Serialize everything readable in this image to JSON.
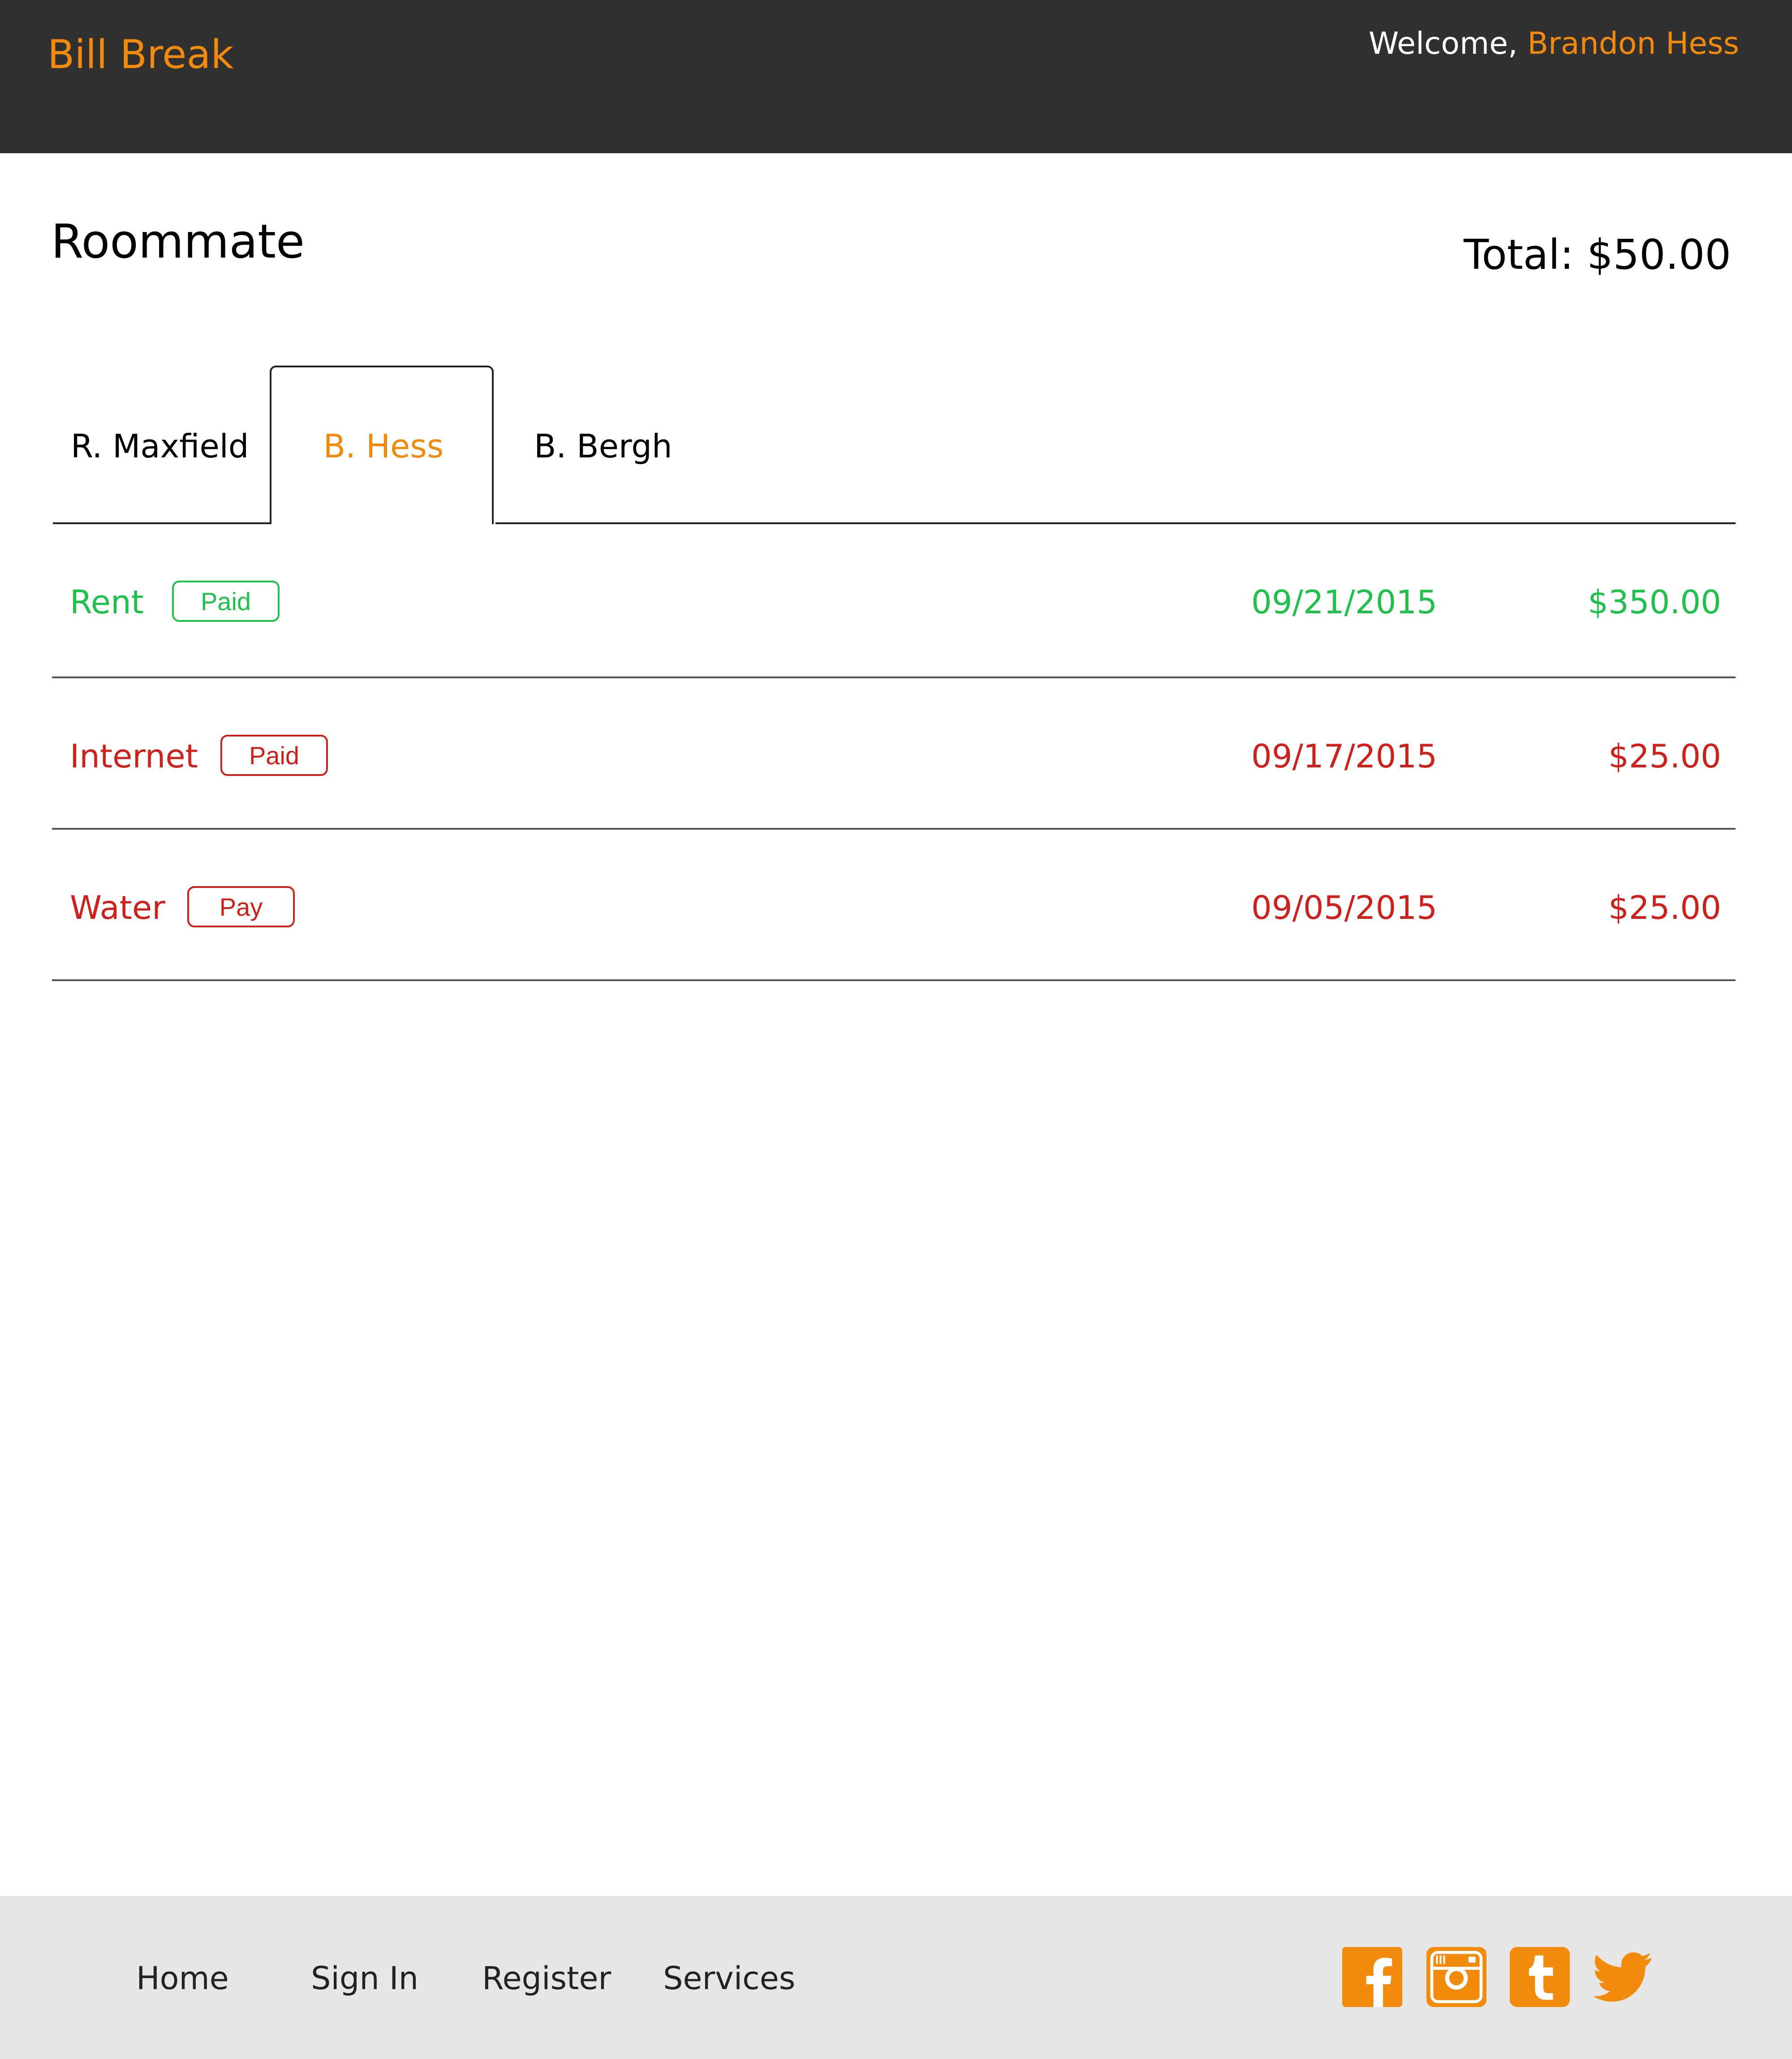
{
  "header": {
    "brand": "Bill Break",
    "welcome_prefix": "Welcome, ",
    "user_name": "Brandon Hess"
  },
  "main": {
    "title": "Roommate",
    "total": "Total: $50.00",
    "tabs": [
      {
        "label": "R. Maxfield",
        "active": false
      },
      {
        "label": "B. Hess",
        "active": true
      },
      {
        "label": "B. Bergh",
        "active": false
      }
    ],
    "bills": [
      {
        "name": "Rent",
        "badge": "Paid",
        "date": "09/21/2015",
        "amount": "$350.00",
        "color": "#1ec24a"
      },
      {
        "name": "Internet",
        "badge": "Paid",
        "date": "09/17/2015",
        "amount": "$25.00",
        "color": "#d0201c"
      },
      {
        "name": "Water",
        "badge": "Pay",
        "date": "09/05/2015",
        "amount": "$25.00",
        "color": "#d0201c"
      }
    ]
  },
  "footer": {
    "links": [
      "Home",
      "Sign In",
      "Register",
      "Services"
    ],
    "social_icons": [
      "facebook-icon",
      "instagram-icon",
      "tumblr-icon",
      "twitter-icon"
    ]
  },
  "colors": {
    "accent": "#f28b0c",
    "header_bg": "#303030",
    "footer_bg": "#e6e6e6",
    "paid_green": "#1ec24a",
    "due_red": "#d0201c"
  }
}
